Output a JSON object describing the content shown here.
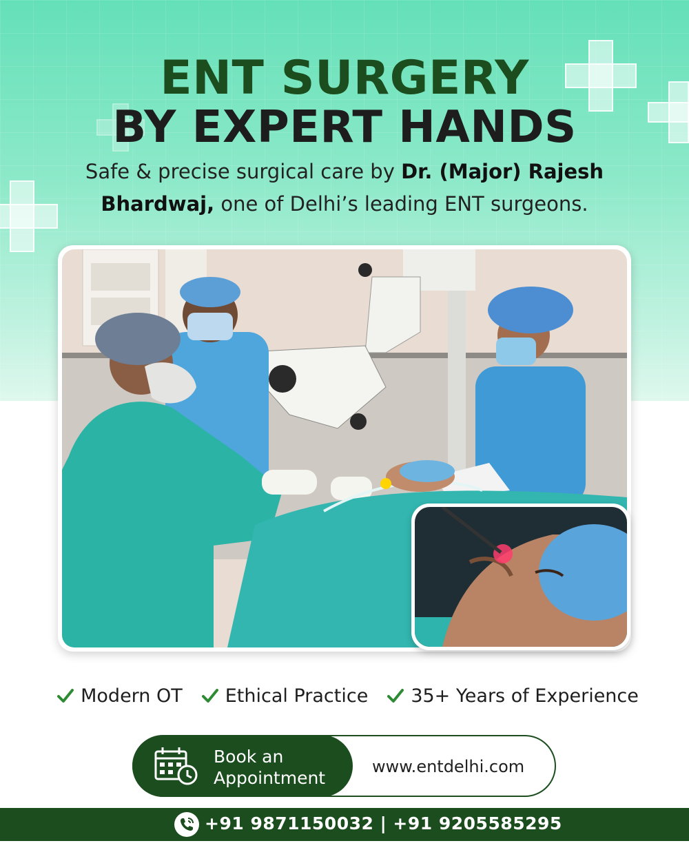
{
  "colors": {
    "brand_green": "#1b4d1e",
    "mint": "#7fe6c2",
    "white": "#ffffff"
  },
  "headline": {
    "line1": "ENT SURGERY",
    "line2": "BY EXPERT HANDS"
  },
  "subheadline": {
    "part1": "Safe & precise surgical care by ",
    "doctor": "Dr. (Major) Rajesh Bhardwaj,",
    "part2": " one of Delhi’s leading ENT surgeons."
  },
  "features": [
    {
      "label": "Modern OT",
      "icon": "check-icon"
    },
    {
      "label": "Ethical Practice",
      "icon": "check-icon"
    },
    {
      "label": "35+ Years of Experience",
      "icon": "check-icon"
    }
  ],
  "cta": {
    "button_line1": "Book an",
    "button_line2": "Appointment",
    "icon": "calendar-clock-icon",
    "website": "www.entdelhi.com"
  },
  "footer": {
    "icon": "phone-icon",
    "phones": "+91 9871150032 | +91 9205585295"
  }
}
